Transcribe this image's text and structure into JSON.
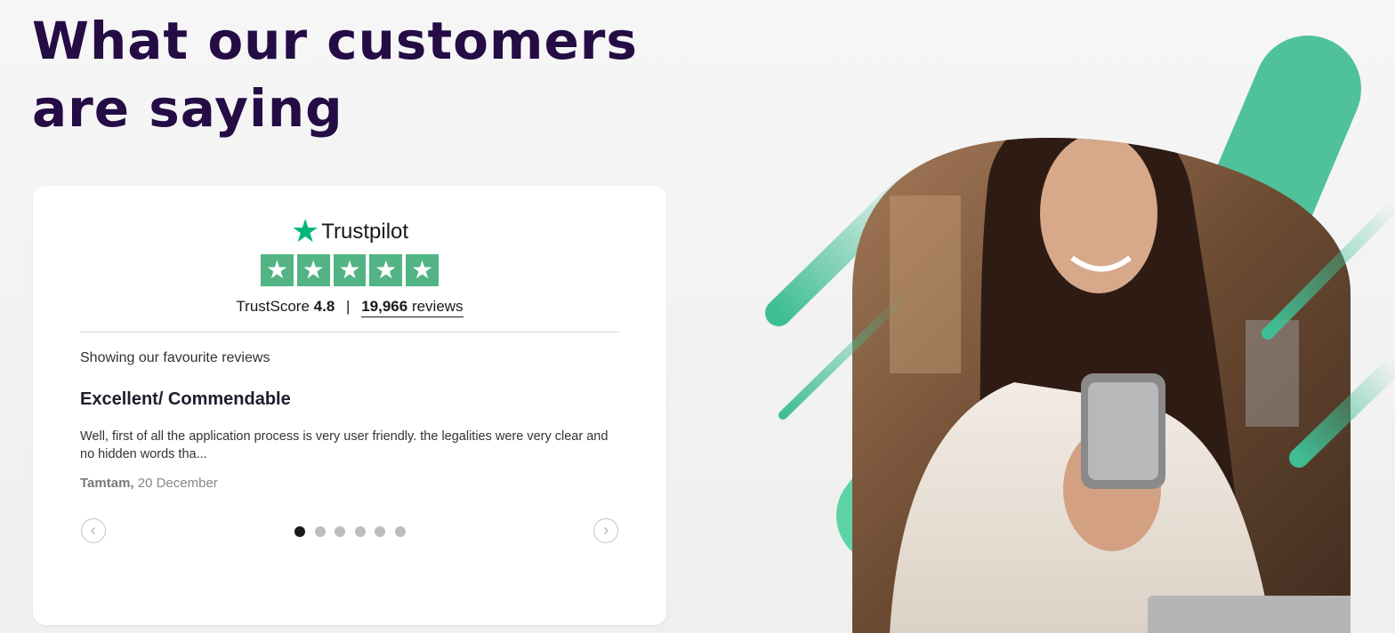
{
  "heading": {
    "line1": "What our customers",
    "line2": "are saying"
  },
  "trustpilot": {
    "logo_star": "★",
    "brand": "Trustpilot",
    "star_glyph": "★",
    "stars": 5,
    "trustscore_label": "TrustScore",
    "trustscore_value": "4.8",
    "separator": "|",
    "review_count": "19,966",
    "reviews_label": "reviews",
    "star_color": "#52b384"
  },
  "reviews": {
    "showing_text": "Showing our favourite reviews",
    "current": {
      "title": "Excellent/ Commendable",
      "body": "Well, first of all the application process is very user friendly. the legalities were very clear and no hidden words tha...",
      "author": "Tamtam,",
      "date": "20 December"
    },
    "pagination": {
      "total": 6,
      "active_index": 0
    }
  },
  "icons": {
    "prev": "chevron-left-icon",
    "next": "chevron-right-icon"
  },
  "colors": {
    "heading": "#250c45",
    "accent": "#3fbe94",
    "brand_green": "#00b67a"
  }
}
